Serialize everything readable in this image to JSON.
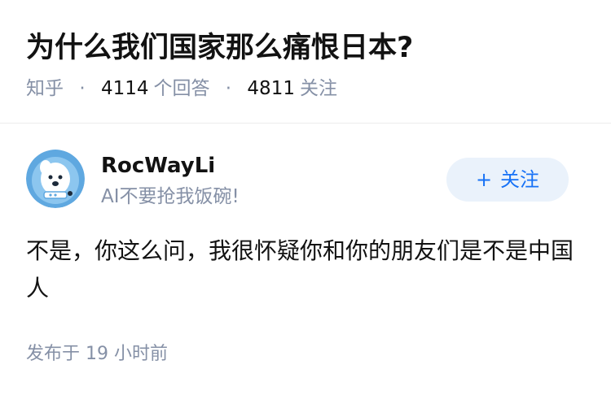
{
  "question": {
    "title": "为什么我们国家那么痛恨日本?",
    "source": "知乎",
    "answer_count": "4114",
    "answer_label": "个回答",
    "follower_count": "4811",
    "follower_label": "关注",
    "separator": "·"
  },
  "author": {
    "name": "RocWayLi",
    "bio": "AI不要抢我饭碗!",
    "follow_plus": "+",
    "follow_label": "关注"
  },
  "answer": {
    "body": "不是，你这么问，我很怀疑你和你的朋友们是不是中国人",
    "time_label": "发布于",
    "time_value": "19 小时前"
  },
  "colors": {
    "muted_text": "#8590a6",
    "primary_text": "#121212",
    "accent_blue": "#1772f6",
    "follow_bg": "#eaf2fb",
    "avatar_bg": "#5fa8e0"
  }
}
